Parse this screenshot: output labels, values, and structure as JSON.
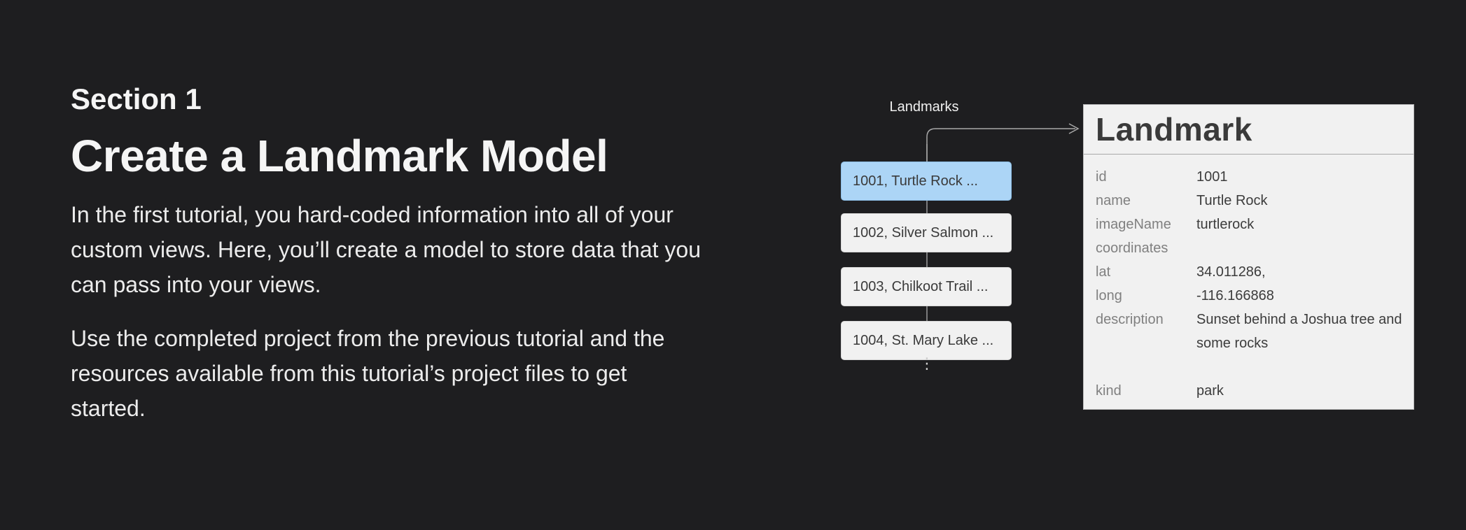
{
  "section": {
    "label": "Section 1",
    "title": "Create a Landmark Model",
    "paragraphs": [
      "In the first tutorial, you hard-coded information into all of your custom views. Here, you’ll create a model to store data that you can pass into your views.",
      "Use the completed project from the previous tutorial and the resources available from this tutorial’s project files to get started."
    ]
  },
  "diagram": {
    "list_label": "Landmarks",
    "list_items": [
      "1001, Turtle Rock ...",
      "1002, Silver Salmon ...",
      "1003, Chilkoot Trail ...",
      "1004, St. Mary Lake ..."
    ],
    "more_indicator": "⋮",
    "selected_index": 0,
    "colors": {
      "selected_row": "#acd5f6",
      "row": "#f1f1f1",
      "background": "#1e1e20"
    },
    "card": {
      "title": "Landmark",
      "fields": [
        {
          "key": "id",
          "value": "1001"
        },
        {
          "key": "name",
          "value": "Turtle Rock"
        },
        {
          "key": "imageName",
          "value": "turtlerock"
        },
        {
          "key": "coordinates",
          "value": ""
        },
        {
          "key": "lat",
          "value": "34.011286,"
        },
        {
          "key": "long",
          "value": "-116.166868"
        },
        {
          "key": "description",
          "value": "Sunset behind a Joshua tree and some rocks"
        },
        {
          "key": "kind",
          "value": "park"
        }
      ]
    }
  }
}
